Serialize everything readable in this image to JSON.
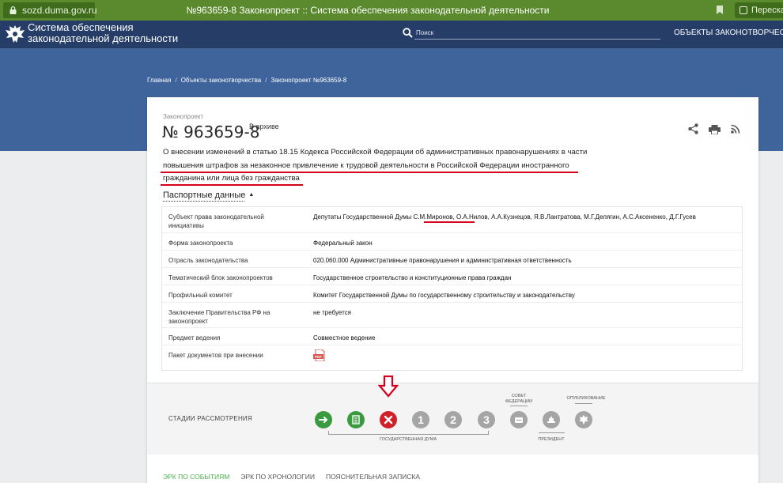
{
  "browser": {
    "url": "sozd.duma.gov.ru",
    "tab_title": "№963659-8 Законопроект :: Система обеспечения законодательной деятельности",
    "translate_label": "Пересказ"
  },
  "header": {
    "brand_line1": "Система обеспечения",
    "brand_line2": "законодательной деятельности",
    "search_placeholder": "Поиск",
    "nav_label": "ОБЪЕКТЫ ЗАКОНОТВОРЧЕСТ"
  },
  "breadcrumb": {
    "items": [
      "Главная",
      "Объекты законотворчества",
      "Законопроект №963659-8"
    ],
    "separator": "/"
  },
  "bill": {
    "kicker": "Законопроект",
    "number": "№ 963659-8",
    "status": "В архиве",
    "description_lines": [
      "О внесении изменений в статью 18.15 Кодекса Российской Федерации об административных правонарушениях в части",
      "повышения штрафов за незаконное привлечение к трудовой деятельности в Российской Федерации иностранного",
      "гражданина или лица без гражданства"
    ]
  },
  "passport": {
    "toggle_label": "Паспортные данные",
    "caret": "▲",
    "rows": [
      {
        "label": "Субъект права законодательной инициативы",
        "value": "Депутаты Государственной Думы С.М.Миронов, О.А.Нилов, А.А.Кузнецов, Я.В.Лантратова, М.Г.Делягин, А.С.Аксененко, Д.Г.Гусев"
      },
      {
        "label": "Форма законопроекта",
        "value": "Федеральный закон"
      },
      {
        "label": "Отрасль законодательства",
        "value": "020.060.000 Административные правонарушения и административная ответственность"
      },
      {
        "label": "Тематический блок законопроектов",
        "value": "Государственное строительство и конституционные права граждан"
      },
      {
        "label": "Профильный комитет",
        "value": "Комитет Государственной Думы по государственному строительству и законодательству"
      },
      {
        "label": "Заключение Правительства РФ на законопроект",
        "value": "не требуется"
      },
      {
        "label": "Предмет ведения",
        "value": "Совместное ведение"
      },
      {
        "label": "Пакет документов при внесении",
        "value": ""
      }
    ],
    "pdf_label": "PDF"
  },
  "stages": {
    "title": "СТАДИИ РАССМОТРЕНИЯ",
    "items": [
      {
        "type": "arrow",
        "color": "#3a9a3f"
      },
      {
        "type": "list",
        "color": "#3a9a3f"
      },
      {
        "type": "cross",
        "color": "#d0202a"
      },
      {
        "type": "number",
        "text": "1",
        "color": "#a5a5a5"
      },
      {
        "type": "number",
        "text": "2",
        "color": "#a5a5a5"
      },
      {
        "type": "number",
        "text": "3",
        "color": "#a5a5a5"
      },
      {
        "type": "federation",
        "color": "#a5a5a5"
      },
      {
        "type": "president",
        "color": "#a5a5a5"
      },
      {
        "type": "publication",
        "color": "#a5a5a5"
      }
    ],
    "caption_duma": "ГОСУДАРСТВЕННАЯ ДУМА",
    "caption_federation_line1": "СОВЕТ",
    "caption_federation_line2": "ФЕДЕРАЦИИ",
    "caption_president": "ПРЕЗИДЕНТ",
    "caption_publication": "ОПУБЛИКОВАНИЕ"
  },
  "tabs": [
    "ЭРК ПО СОБЫТИЯМ",
    "ЭРК ПО ХРОНОЛОГИИ",
    "ПОЯСНИТЕЛЬНАЯ ЗАПИСКА"
  ],
  "colors": {
    "header": "#253d67",
    "hero": "#3f639b",
    "browser": "#5b8a2e",
    "accent_red": "#d6001c",
    "active_tab": "#4caf50"
  }
}
